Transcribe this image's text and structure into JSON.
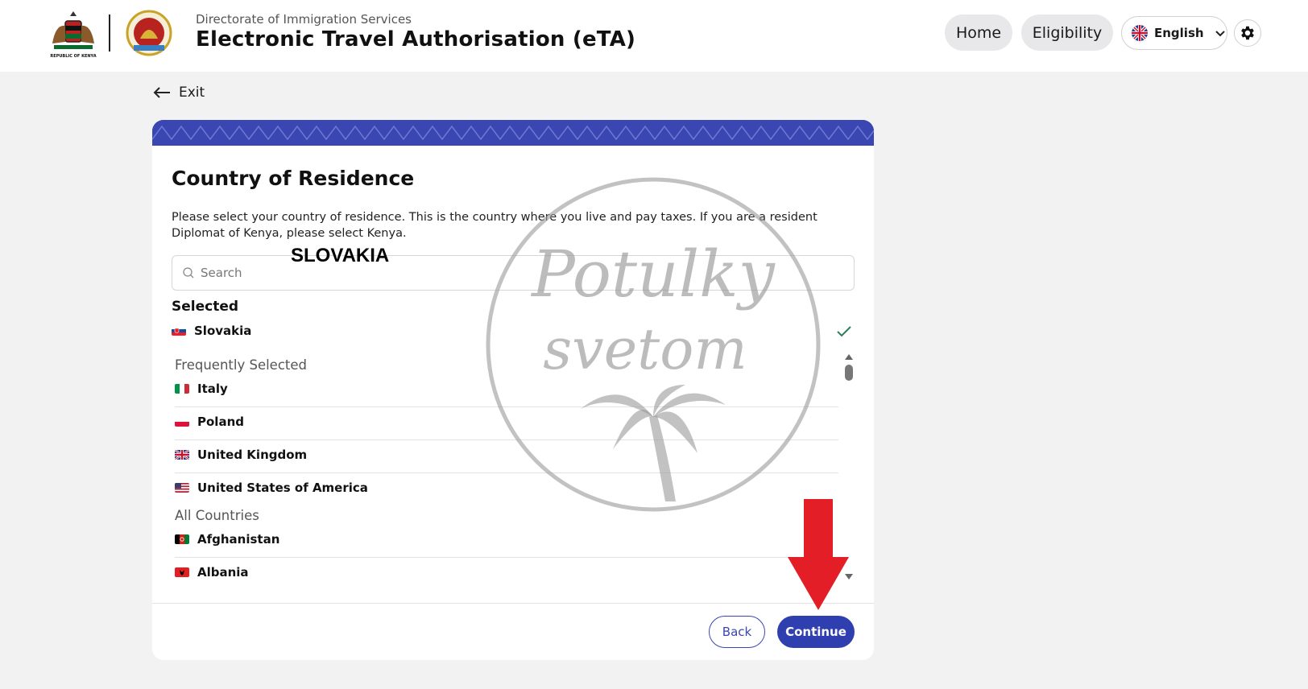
{
  "header": {
    "coat_of_arms_text": "REPUBLIC OF KENYA",
    "subtitle": "Directorate of Immigration Services",
    "title": "Electronic Travel Authorisation (eTA)",
    "nav": {
      "home": "Home",
      "eligibility": "Eligibility"
    },
    "language": "English",
    "settings_icon": "gear-icon"
  },
  "exit_label": "Exit",
  "card": {
    "title": "Country of Residence",
    "description": "Please select your country of residence. This is the country where you live and pay taxes. If you are a resident Diplomat of Kenya, please select Kenya.",
    "search": {
      "placeholder": "Search",
      "value": ""
    },
    "search_overlay_text": "SLOVAKIA",
    "selected_heading": "Selected",
    "selected_country": "Slovakia",
    "frequent_heading": "Frequently Selected",
    "frequent": [
      "Italy",
      "Poland",
      "United Kingdom",
      "United States of America"
    ],
    "all_heading": "All Countries",
    "all": [
      "Afghanistan",
      "Albania"
    ],
    "buttons": {
      "back": "Back",
      "continue": "Continue"
    }
  },
  "watermark_text": [
    "Potulky",
    "svetom"
  ],
  "colors": {
    "brand_blue": "#2f3fb0",
    "banner": "#3a46b2",
    "check_green": "#2e7d5b",
    "arrow_red": "#e41e26"
  }
}
